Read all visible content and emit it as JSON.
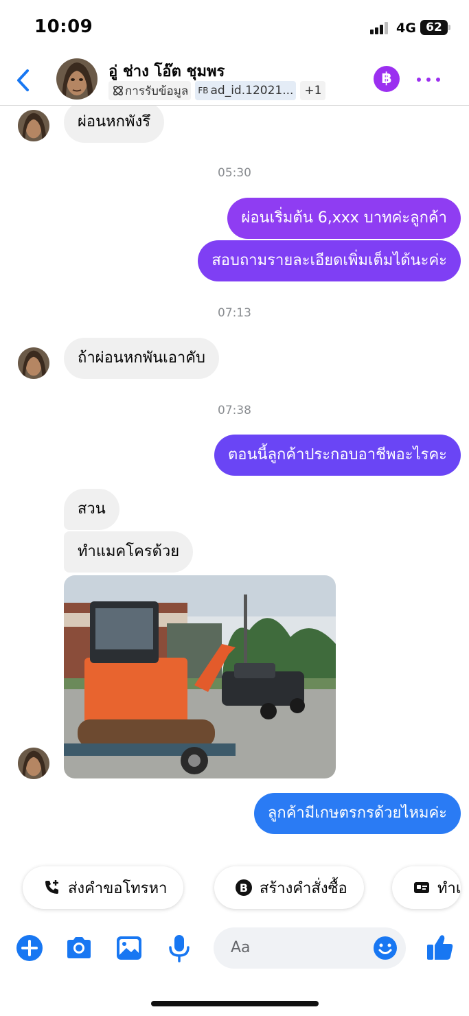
{
  "status_bar": {
    "time": "10:09",
    "network": "4G",
    "battery": "62"
  },
  "header": {
    "contact_name": "อู่ ช่าง โอ๊ต ชุมพร",
    "tags": {
      "info": "การรับข้อมูล",
      "ad_prefix": "FB",
      "ad": "ad_id.12021...",
      "more": "+1"
    },
    "baht_label": "฿"
  },
  "messages": [
    {
      "dir": "in",
      "text": "ผ่อนหกพังรึ"
    },
    {
      "dir": "stamp",
      "text": "05:30"
    },
    {
      "dir": "out",
      "text": "ผ่อนเริ่มต้น 6,xxx บาทค่ะลูกค้า"
    },
    {
      "dir": "out",
      "text": "สอบถามรายละเอียดเพิ่มเต็มได้นะค่ะ"
    },
    {
      "dir": "stamp",
      "text": "07:13"
    },
    {
      "dir": "in",
      "text": "ถ้าผ่อนหกพันเอาคับ"
    },
    {
      "dir": "stamp",
      "text": "07:38"
    },
    {
      "dir": "out",
      "text": "ตอนนี้ลูกค้าประกอบอาชีพอะไรคะ"
    },
    {
      "dir": "in",
      "text": "สวน"
    },
    {
      "dir": "in",
      "text": "ทำแมคโครด้วย"
    },
    {
      "dir": "in",
      "type": "photo",
      "description": "excavator-on-trailer"
    },
    {
      "dir": "out",
      "text": "ลูกค้ามีเกษตรกรด้วยไหมค่ะ"
    }
  ],
  "quick_actions": [
    "ส่งคำขอโทรหา",
    "สร้างคำสั่งซื้อ",
    "ทำเ"
  ],
  "composer": {
    "placeholder": "Aa"
  },
  "colors": {
    "accent_purple": "#9b2ff0",
    "bubble_purple": "#7a3ff5",
    "bubble_blue": "#2a7bf4",
    "icon_blue": "#1877f2",
    "incoming_bg": "#f0f0f0"
  }
}
